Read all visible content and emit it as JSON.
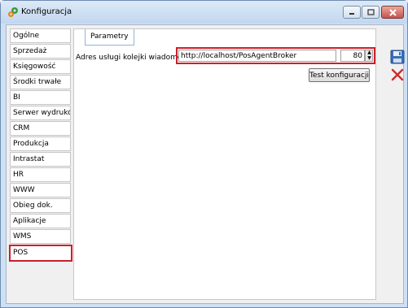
{
  "window": {
    "title": "Konfiguracja"
  },
  "sidebar": {
    "items": [
      {
        "label": "Ogólne"
      },
      {
        "label": "Sprzedaż"
      },
      {
        "label": "Księgowość"
      },
      {
        "label": "Środki trwałe"
      },
      {
        "label": "BI"
      },
      {
        "label": "Serwer wydruków"
      },
      {
        "label": "CRM"
      },
      {
        "label": "Produkcja"
      },
      {
        "label": "Intrastat"
      },
      {
        "label": "HR"
      },
      {
        "label": "WWW"
      },
      {
        "label": "Obieg dok."
      },
      {
        "label": "Aplikacje"
      },
      {
        "label": "WMS"
      },
      {
        "label": "POS",
        "active": true
      }
    ]
  },
  "main": {
    "tab_label": "Parametry",
    "field_label": "Adres usługi kolejki wiadomości:",
    "url_value": "http://localhost/PosAgentBroker",
    "port_value": "80",
    "test_button_label": "Test konfiguracji"
  },
  "colors": {
    "highlight": "#cc1e2b",
    "title_bar": "#c2d7ef"
  },
  "icons": {
    "title": "gears-icon",
    "save": "floppy-disk-icon",
    "cancel": "red-x-icon"
  }
}
